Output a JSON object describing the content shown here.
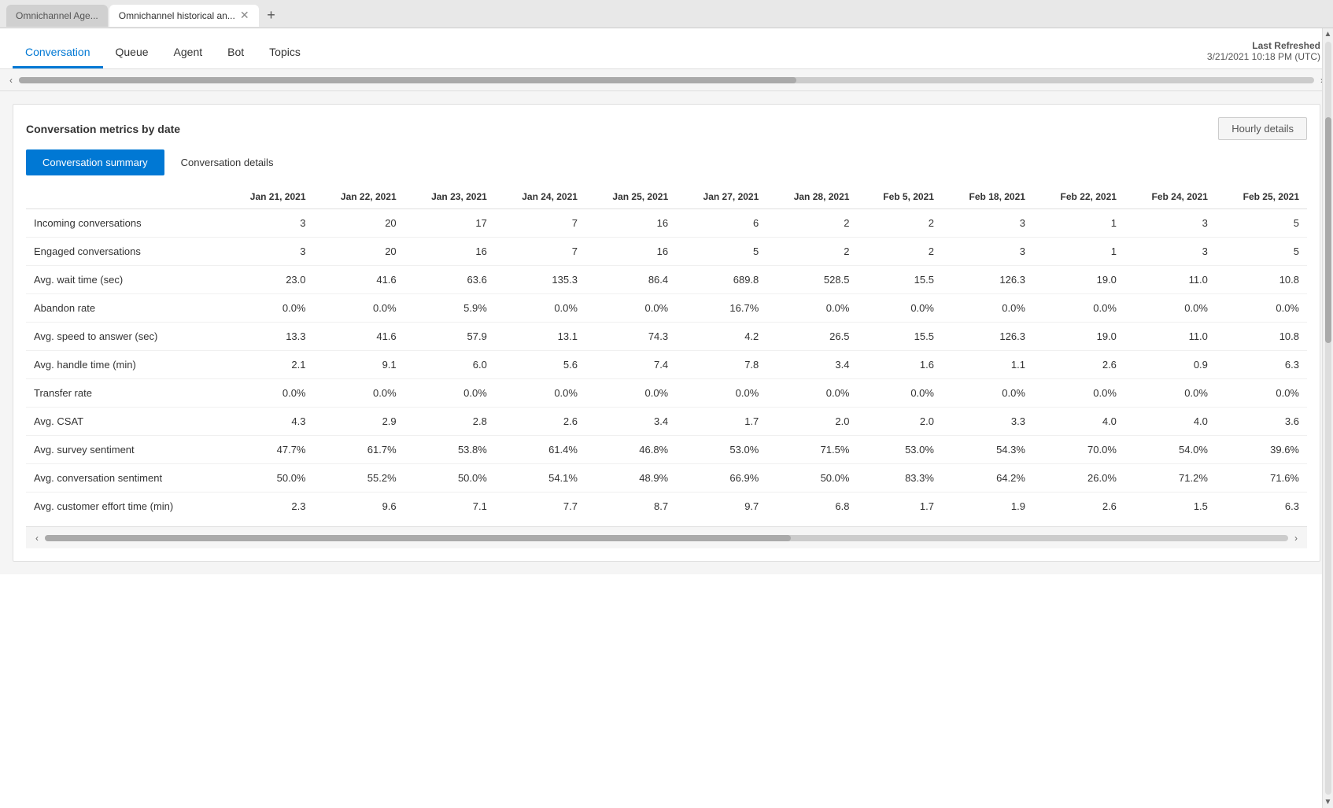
{
  "browser": {
    "tabs": [
      {
        "id": "tab1",
        "label": "Omnichannel Age...",
        "active": false,
        "closeable": false
      },
      {
        "id": "tab2",
        "label": "Omnichannel historical an...",
        "active": true,
        "closeable": true
      }
    ],
    "new_tab_icon": "+"
  },
  "nav": {
    "tabs": [
      {
        "id": "conversation",
        "label": "Conversation",
        "active": true
      },
      {
        "id": "queue",
        "label": "Queue",
        "active": false
      },
      {
        "id": "agent",
        "label": "Agent",
        "active": false
      },
      {
        "id": "bot",
        "label": "Bot",
        "active": false
      },
      {
        "id": "topics",
        "label": "Topics",
        "active": false
      }
    ],
    "last_refreshed_label": "Last Refreshed",
    "last_refreshed_value": "3/21/2021 10:18 PM (UTC)"
  },
  "metrics_panel": {
    "title": "Conversation metrics by date",
    "hourly_btn_label": "Hourly details",
    "tabs": [
      {
        "id": "summary",
        "label": "Conversation summary",
        "active": true
      },
      {
        "id": "details",
        "label": "Conversation details",
        "active": false
      }
    ],
    "table": {
      "columns": [
        "",
        "Jan 21, 2021",
        "Jan 22, 2021",
        "Jan 23, 2021",
        "Jan 24, 2021",
        "Jan 25, 2021",
        "Jan 27, 2021",
        "Jan 28, 2021",
        "Feb 5, 2021",
        "Feb 18, 2021",
        "Feb 22, 2021",
        "Feb 24, 2021",
        "Feb 25, 2021"
      ],
      "rows": [
        {
          "metric": "Incoming conversations",
          "values": [
            "3",
            "20",
            "17",
            "7",
            "16",
            "6",
            "2",
            "2",
            "3",
            "1",
            "3",
            "5"
          ]
        },
        {
          "metric": "Engaged conversations",
          "values": [
            "3",
            "20",
            "16",
            "7",
            "16",
            "5",
            "2",
            "2",
            "3",
            "1",
            "3",
            "5"
          ]
        },
        {
          "metric": "Avg. wait time (sec)",
          "values": [
            "23.0",
            "41.6",
            "63.6",
            "135.3",
            "86.4",
            "689.8",
            "528.5",
            "15.5",
            "126.3",
            "19.0",
            "11.0",
            "10.8"
          ]
        },
        {
          "metric": "Abandon rate",
          "values": [
            "0.0%",
            "0.0%",
            "5.9%",
            "0.0%",
            "0.0%",
            "16.7%",
            "0.0%",
            "0.0%",
            "0.0%",
            "0.0%",
            "0.0%",
            "0.0%"
          ]
        },
        {
          "metric": "Avg. speed to answer (sec)",
          "values": [
            "13.3",
            "41.6",
            "57.9",
            "13.1",
            "74.3",
            "4.2",
            "26.5",
            "15.5",
            "126.3",
            "19.0",
            "11.0",
            "10.8"
          ]
        },
        {
          "metric": "Avg. handle time (min)",
          "values": [
            "2.1",
            "9.1",
            "6.0",
            "5.6",
            "7.4",
            "7.8",
            "3.4",
            "1.6",
            "1.1",
            "2.6",
            "0.9",
            "6.3"
          ]
        },
        {
          "metric": "Transfer rate",
          "values": [
            "0.0%",
            "0.0%",
            "0.0%",
            "0.0%",
            "0.0%",
            "0.0%",
            "0.0%",
            "0.0%",
            "0.0%",
            "0.0%",
            "0.0%",
            "0.0%"
          ]
        },
        {
          "metric": "Avg. CSAT",
          "values": [
            "4.3",
            "2.9",
            "2.8",
            "2.6",
            "3.4",
            "1.7",
            "2.0",
            "2.0",
            "3.3",
            "4.0",
            "4.0",
            "3.6"
          ]
        },
        {
          "metric": "Avg. survey sentiment",
          "values": [
            "47.7%",
            "61.7%",
            "53.8%",
            "61.4%",
            "46.8%",
            "53.0%",
            "71.5%",
            "53.0%",
            "54.3%",
            "70.0%",
            "54.0%",
            "39.6%"
          ]
        },
        {
          "metric": "Avg. conversation sentiment",
          "values": [
            "50.0%",
            "55.2%",
            "50.0%",
            "54.1%",
            "48.9%",
            "66.9%",
            "50.0%",
            "83.3%",
            "64.2%",
            "26.0%",
            "71.2%",
            "71.6%"
          ]
        },
        {
          "metric": "Avg. customer effort time (min)",
          "values": [
            "2.3",
            "9.6",
            "7.1",
            "7.7",
            "8.7",
            "9.7",
            "6.8",
            "1.7",
            "1.9",
            "2.6",
            "1.5",
            "6.3"
          ]
        }
      ]
    }
  }
}
